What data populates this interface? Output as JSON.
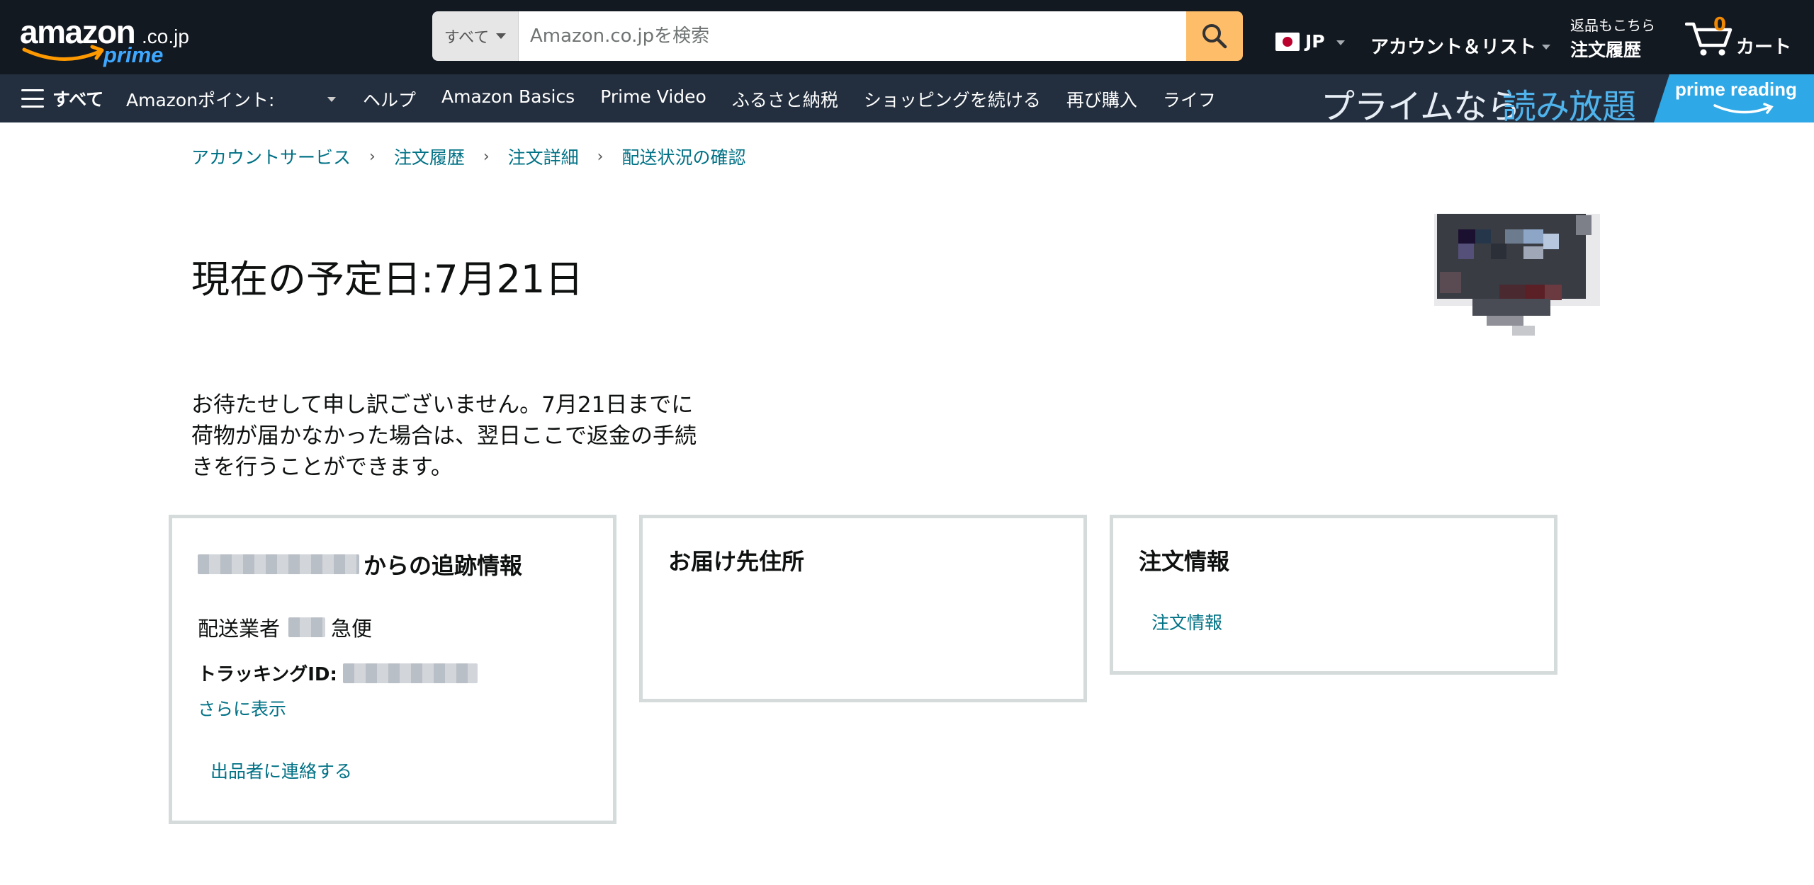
{
  "header": {
    "logo_main": "amazon",
    "logo_domain": ".co.jp",
    "logo_prime": "prime",
    "search_dept": "すべて",
    "search_placeholder": "Amazon.co.jpを検索",
    "locale": "JP",
    "account": "アカウント＆リスト",
    "orders_line1": "返品もこちら",
    "orders_line2": "注文履歴",
    "cart_count": "0",
    "cart_label": "カート"
  },
  "subnav": {
    "all": "すべて",
    "points": "Amazonポイント:",
    "links": [
      "ヘルプ",
      "Amazon Basics",
      "Prime Video",
      "ふるさと納税",
      "ショッピングを続ける",
      "再び購入",
      "ライフ"
    ],
    "banner_a": "プライムなら",
    "banner_b": "読み放題",
    "banner_brand": "prime reading"
  },
  "breadcrumb": [
    "アカウントサービス",
    "注文履歴",
    "注文詳細",
    "配送状況の確認"
  ],
  "delivery": {
    "title": "現在の予定日:7月21日",
    "apology_lines": [
      "お待たせして申し訳ございません。7月21日までに",
      "荷物が届かなかった場合は、翌日ここで返金の手続",
      "きを行うことができます。"
    ]
  },
  "tracking_box": {
    "title_suffix": "からの追跡情報",
    "carrier_label": "配送業者",
    "carrier_suffix": "急便",
    "tracking_label": "トラッキングID:",
    "more_link": "さらに表示",
    "contact_link": "出品者に連絡する"
  },
  "address_box": {
    "title": "お届け先住所"
  },
  "order_box": {
    "title": "注文情報",
    "link": "注文情報"
  },
  "colors": {
    "nav_dark": "#131921",
    "nav_sub": "#232f3e",
    "search_button": "#febd69",
    "link": "#007185",
    "box_border": "#d5dbdb"
  }
}
